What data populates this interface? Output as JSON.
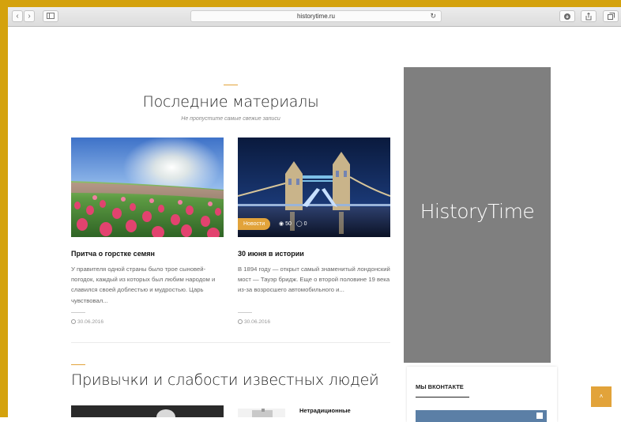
{
  "browser": {
    "url": "historytime.ru",
    "nav_back": "‹",
    "nav_forward": "›",
    "reload_icon": "↻"
  },
  "section1": {
    "title": "Последние материалы",
    "subtitle": "Не пропустите самые свежие записи"
  },
  "posts": [
    {
      "title": "Притча о горстке семян",
      "excerpt": "У правителя одной страны было трое сыновей-погодок, каждый из которых был любим народом и славился своей доблестью и мудростью. Царь чувствовал...",
      "date": "30.06.2016"
    },
    {
      "title": "30 июня в истории",
      "excerpt": "В 1894 году — открыт самый знаменитый лондонский мост — Тауэр бридж. Еще о второй половине 19 века из-за возросшего автомобильного и...",
      "date": "30.06.2016",
      "badge": "Новости",
      "views": "50",
      "comments": "0"
    }
  ],
  "section2": {
    "title": "Привычки и слабости известных людей",
    "item_title": "Нетрадиционные"
  },
  "sidebar": {
    "banner_text": "HistoryTime",
    "vk_title": "МЫ ВКОНТАКТЕ"
  },
  "scroll_top_icon": "˄",
  "colors": {
    "accent": "#e2a33a",
    "frame": "#d4a20d",
    "banner_bg": "#7f7f7f"
  }
}
